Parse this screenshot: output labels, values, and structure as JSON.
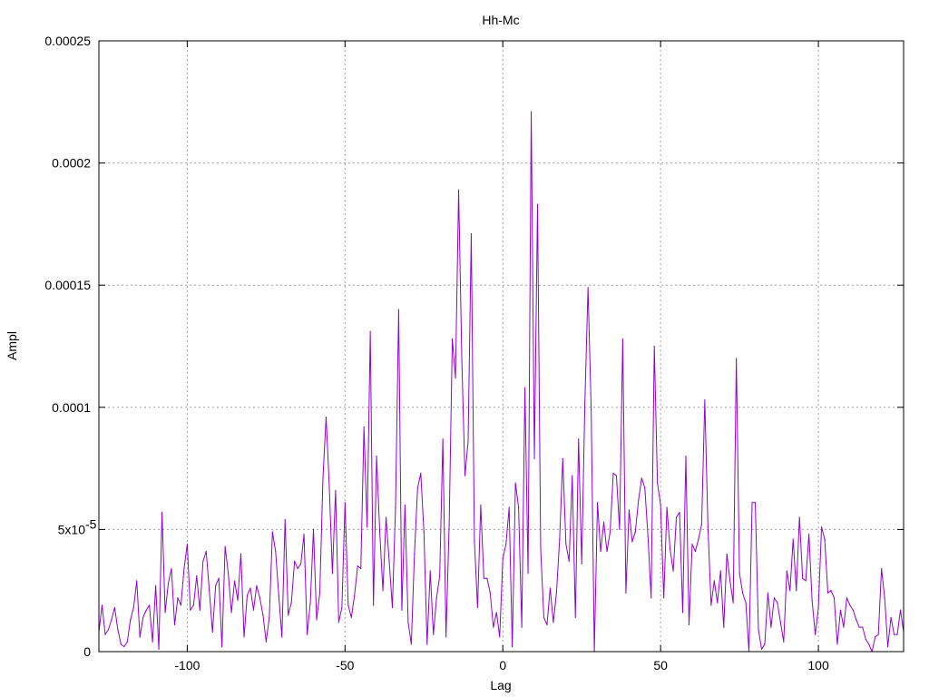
{
  "chart_data": {
    "type": "line",
    "title": "Hh-Mc",
    "xlabel": "Lag",
    "ylabel": "Ampl",
    "xlim": [
      -128,
      127
    ],
    "ylim": [
      0,
      0.00025
    ],
    "grid": true,
    "x_ticks": [
      {
        "value": -100,
        "label": "-100"
      },
      {
        "value": -50,
        "label": "-50"
      },
      {
        "value": 0,
        "label": "0"
      },
      {
        "value": 50,
        "label": "50"
      },
      {
        "value": 100,
        "label": "100"
      }
    ],
    "y_ticks": [
      {
        "value": 0,
        "label": "0"
      },
      {
        "value": 5e-05,
        "label": "5x10",
        "sup": "-5"
      },
      {
        "value": 0.0001,
        "label": "0.0001"
      },
      {
        "value": 0.00015,
        "label": "0.00015"
      },
      {
        "value": 0.0002,
        "label": "0.0002"
      },
      {
        "value": 0.00025,
        "label": "0.00025"
      }
    ],
    "series": [
      {
        "color": "#9400d3",
        "points": [
          [
            -128,
            8e-06
          ],
          [
            -127,
            1.9e-05
          ],
          [
            -126,
            7e-06
          ],
          [
            -125,
            9e-06
          ],
          [
            -124,
            1.3e-05
          ],
          [
            -123,
            1.8e-05
          ],
          [
            -122,
            9e-06
          ],
          [
            -121,
            3e-06
          ],
          [
            -120,
            2e-06
          ],
          [
            -119,
            4e-06
          ],
          [
            -118,
            1.3e-05
          ],
          [
            -117,
            1.8e-05
          ],
          [
            -116,
            2.9e-05
          ],
          [
            -115,
            6e-06
          ],
          [
            -114,
            1.4e-05
          ],
          [
            -113,
            1.7e-05
          ],
          [
            -112,
            1.9e-05
          ],
          [
            -111,
            4e-06
          ],
          [
            -110,
            2.7e-05
          ],
          [
            -109,
            1e-06
          ],
          [
            -108,
            5.7e-05
          ],
          [
            -107,
            1.6e-05
          ],
          [
            -106,
            2.8e-05
          ],
          [
            -105,
            3.4e-05
          ],
          [
            -104,
            1.1e-05
          ],
          [
            -103,
            2.2e-05
          ],
          [
            -102,
            1.9e-05
          ],
          [
            -101,
            3.4e-05
          ],
          [
            -100,
            4.4e-05
          ],
          [
            -99,
            1.7e-05
          ],
          [
            -98,
            1.9e-05
          ],
          [
            -97,
            3.1e-05
          ],
          [
            -96,
            1.7e-05
          ],
          [
            -95,
            3.7e-05
          ],
          [
            -94,
            4.1e-05
          ],
          [
            -93,
            2.5e-05
          ],
          [
            -92,
            8e-06
          ],
          [
            -91,
            2.7e-05
          ],
          [
            -90,
            3e-05
          ],
          [
            -89,
            2e-06
          ],
          [
            -88,
            4.3e-05
          ],
          [
            -87,
            3.2e-05
          ],
          [
            -86,
            1.6e-05
          ],
          [
            -85,
            2.9e-05
          ],
          [
            -84,
            2.1e-05
          ],
          [
            -83,
            4e-05
          ],
          [
            -82,
            6e-06
          ],
          [
            -81,
            2.3e-05
          ],
          [
            -80,
            2.6e-05
          ],
          [
            -79,
            1.7e-05
          ],
          [
            -78,
            2.7e-05
          ],
          [
            -77,
            2.2e-05
          ],
          [
            -76,
            1.5e-05
          ],
          [
            -75,
            4e-06
          ],
          [
            -74,
            1.4e-05
          ],
          [
            -73,
            4.9e-05
          ],
          [
            -72,
            4.1e-05
          ],
          [
            -71,
            2.3e-05
          ],
          [
            -70,
            6e-06
          ],
          [
            -69,
            5.4e-05
          ],
          [
            -68,
            1.5e-05
          ],
          [
            -67,
            2e-05
          ],
          [
            -66,
            3.7e-05
          ],
          [
            -65,
            3.4e-05
          ],
          [
            -64,
            3.6e-05
          ],
          [
            -63,
            4.8e-05
          ],
          [
            -62,
            7e-06
          ],
          [
            -61,
            2e-05
          ],
          [
            -60,
            5e-05
          ],
          [
            -59,
            1.3e-05
          ],
          [
            -58,
            2.4e-05
          ],
          [
            -57,
            7.1e-05
          ],
          [
            -56,
            9.6e-05
          ],
          [
            -55,
            6.8e-05
          ],
          [
            -54,
            3.2e-05
          ],
          [
            -53,
            6.6e-05
          ],
          [
            -52,
            1.2e-05
          ],
          [
            -51,
            1.8e-05
          ],
          [
            -50,
            6.1e-05
          ],
          [
            -49,
            1.9e-05
          ],
          [
            -48,
            1.4e-05
          ],
          [
            -47,
            2.3e-05
          ],
          [
            -46,
            3.5e-05
          ],
          [
            -45,
            3.4e-05
          ],
          [
            -44,
            9.2e-05
          ],
          [
            -43,
            5.1e-05
          ],
          [
            -42,
            0.000131
          ],
          [
            -41,
            1.9e-05
          ],
          [
            -40,
            8e-05
          ],
          [
            -39,
            4.9e-05
          ],
          [
            -38,
            2.5e-05
          ],
          [
            -37,
            5.5e-05
          ],
          [
            -36,
            3.7e-05
          ],
          [
            -35,
            1.8e-05
          ],
          [
            -34,
            5.9e-05
          ],
          [
            -33,
            0.00014
          ],
          [
            -32,
            1.7e-05
          ],
          [
            -31,
            6e-05
          ],
          [
            -30,
            1.2e-05
          ],
          [
            -29,
            3e-06
          ],
          [
            -28,
            4e-05
          ],
          [
            -27,
            6.7e-05
          ],
          [
            -26,
            7.3e-05
          ],
          [
            -25,
            4.9e-05
          ],
          [
            -24,
            3e-06
          ],
          [
            -23,
            3.3e-05
          ],
          [
            -22,
            7e-06
          ],
          [
            -21,
            2.2e-05
          ],
          [
            -20,
            3.1e-05
          ],
          [
            -19,
            8.7e-05
          ],
          [
            -18,
            6e-06
          ],
          [
            -17,
            5.2e-05
          ],
          [
            -16,
            0.000128
          ],
          [
            -15,
            0.000112
          ],
          [
            -14,
            0.000189
          ],
          [
            -13,
            0.00012
          ],
          [
            -12,
            7.2e-05
          ],
          [
            -11,
            8.6e-05
          ],
          [
            -10,
            0.000171
          ],
          [
            -9,
            4.5e-05
          ],
          [
            -8,
            1.8e-05
          ],
          [
            -7,
            6e-05
          ],
          [
            -6,
            3e-05
          ],
          [
            -5,
            3e-05
          ],
          [
            -4,
            2.4e-05
          ],
          [
            -3,
            1e-05
          ],
          [
            -2,
            1.6e-05
          ],
          [
            -1,
            6e-06
          ],
          [
            0,
            3.8e-05
          ],
          [
            1,
            4.4e-05
          ],
          [
            2,
            5.9e-05
          ],
          [
            3,
            2e-06
          ],
          [
            4,
            6.9e-05
          ],
          [
            5,
            5.9e-05
          ],
          [
            6,
            1e-05
          ],
          [
            7,
            0.000108
          ],
          [
            8,
            3.2e-05
          ],
          [
            9,
            0.000221
          ],
          [
            10,
            7.9e-05
          ],
          [
            11,
            0.000183
          ],
          [
            12,
            4.2e-05
          ],
          [
            13,
            1.4e-05
          ],
          [
            14,
            1.1e-05
          ],
          [
            15,
            2.6e-05
          ],
          [
            16,
            1.2e-05
          ],
          [
            17,
            2.4e-05
          ],
          [
            18,
            4.6e-05
          ],
          [
            19,
            7.9e-05
          ],
          [
            20,
            4.4e-05
          ],
          [
            21,
            3.7e-05
          ],
          [
            22,
            7.2e-05
          ],
          [
            23,
            1.4e-05
          ],
          [
            24,
            8.7e-05
          ],
          [
            25,
            3.6e-05
          ],
          [
            26,
            0.000102
          ],
          [
            27,
            0.000149
          ],
          [
            28,
            9.9e-05
          ],
          [
            29,
            0.0
          ],
          [
            30,
            6.1e-05
          ],
          [
            31,
            4.1e-05
          ],
          [
            32,
            5.3e-05
          ],
          [
            33,
            4.1e-05
          ],
          [
            34,
            4.9e-05
          ],
          [
            35,
            7.3e-05
          ],
          [
            36,
            7.2e-05
          ],
          [
            37,
            5e-05
          ],
          [
            38,
            0.000128
          ],
          [
            39,
            2.4e-05
          ],
          [
            40,
            5.8e-05
          ],
          [
            41,
            4.5e-05
          ],
          [
            42,
            4.9e-05
          ],
          [
            43,
            6.2e-05
          ],
          [
            44,
            7.1e-05
          ],
          [
            45,
            6.7e-05
          ],
          [
            46,
            4.7e-05
          ],
          [
            47,
            2.2e-05
          ],
          [
            48,
            0.000125
          ],
          [
            49,
            6.9e-05
          ],
          [
            50,
            6e-05
          ],
          [
            51,
            2.2e-05
          ],
          [
            52,
            5.9e-05
          ],
          [
            53,
            4.2e-05
          ],
          [
            54,
            3.3e-05
          ],
          [
            55,
            5.5e-05
          ],
          [
            56,
            5.7e-05
          ],
          [
            57,
            1.6e-05
          ],
          [
            58,
            8e-05
          ],
          [
            59,
            1.1e-05
          ],
          [
            60,
            4.4e-05
          ],
          [
            61,
            4.1e-05
          ],
          [
            62,
            4.6e-05
          ],
          [
            63,
            5.2e-05
          ],
          [
            64,
            0.000103
          ],
          [
            65,
            5.1e-05
          ],
          [
            66,
            1.9e-05
          ],
          [
            67,
            2.9e-05
          ],
          [
            68,
            2e-05
          ],
          [
            69,
            3.3e-05
          ],
          [
            70,
            1e-05
          ],
          [
            71,
            4e-05
          ],
          [
            72,
            2.9e-05
          ],
          [
            73,
            2e-05
          ],
          [
            74,
            0.00012
          ],
          [
            75,
            3.2e-05
          ],
          [
            76,
            2.4e-05
          ],
          [
            77,
            2e-05
          ],
          [
            78,
            0.0
          ],
          [
            79,
            6.1e-05
          ],
          [
            80,
            6.1e-05
          ],
          [
            81,
            9e-06
          ],
          [
            82,
            1e-06
          ],
          [
            83,
            3e-06
          ],
          [
            84,
            2.4e-05
          ],
          [
            85,
            1e-05
          ],
          [
            86,
            2.2e-05
          ],
          [
            87,
            2e-05
          ],
          [
            88,
            1.2e-05
          ],
          [
            89,
            4e-06
          ],
          [
            90,
            3.3e-05
          ],
          [
            91,
            2.5e-05
          ],
          [
            92,
            4.6e-05
          ],
          [
            93,
            2.5e-05
          ],
          [
            94,
            5.5e-05
          ],
          [
            95,
            3e-05
          ],
          [
            96,
            2.9e-05
          ],
          [
            97,
            4.8e-05
          ],
          [
            98,
            2.1e-05
          ],
          [
            99,
            7e-06
          ],
          [
            100,
            1.8e-05
          ],
          [
            101,
            5.1e-05
          ],
          [
            102,
            4.6e-05
          ],
          [
            103,
            2.4e-05
          ],
          [
            104,
            2.5e-05
          ],
          [
            105,
            2.2e-05
          ],
          [
            106,
            3e-06
          ],
          [
            107,
            1.7e-05
          ],
          [
            108,
            1e-05
          ],
          [
            109,
            2.2e-05
          ],
          [
            110,
            1.9e-05
          ],
          [
            111,
            1.7e-05
          ],
          [
            112,
            1.3e-05
          ],
          [
            113,
            1e-05
          ],
          [
            114,
            1e-05
          ],
          [
            115,
            5e-06
          ],
          [
            116,
            3e-06
          ],
          [
            117,
            0.0
          ],
          [
            118,
            6e-06
          ],
          [
            119,
            7e-06
          ],
          [
            120,
            3.4e-05
          ],
          [
            121,
            2.2e-05
          ],
          [
            122,
            2e-06
          ],
          [
            123,
            1.4e-05
          ],
          [
            124,
            7e-06
          ],
          [
            125,
            7e-06
          ],
          [
            126,
            1.7e-05
          ],
          [
            127,
            8e-06
          ]
        ]
      }
    ]
  }
}
